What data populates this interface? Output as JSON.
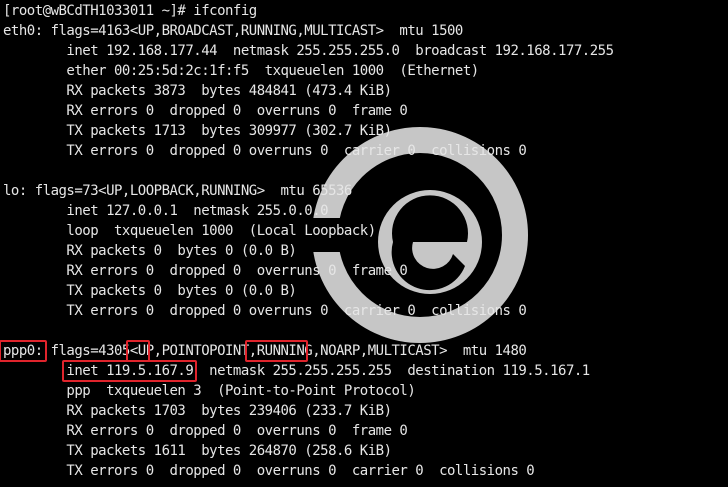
{
  "window": {
    "title": "",
    "background": "#000000",
    "text_color": "#e6e6e6",
    "highlight_color": "#e0242c"
  },
  "terminal": {
    "lines": [
      "[root@wBCdTH1033011 ~]# ifconfig",
      "eth0: flags=4163<UP,BROADCAST,RUNNING,MULTICAST>  mtu 1500",
      "        inet 192.168.177.44  netmask 255.255.255.0  broadcast 192.168.177.255",
      "        ether 00:25:5d:2c:1f:f5  txqueuelen 1000  (Ethernet)",
      "        RX packets 3873  bytes 484841 (473.4 KiB)",
      "        RX errors 0  dropped 0  overruns 0  frame 0",
      "        TX packets 1713  bytes 309977 (302.7 KiB)",
      "        TX errors 0  dropped 0 overruns 0  carrier 0  collisions 0",
      "",
      "lo: flags=73<UP,LOOPBACK,RUNNING>  mtu 65536",
      "        inet 127.0.0.1  netmask 255.0.0.0",
      "        loop  txqueuelen 1000  (Local Loopback)",
      "        RX packets 0  bytes 0 (0.0 B)",
      "        RX errors 0  dropped 0  overruns 0  frame 0",
      "        TX packets 0  bytes 0 (0.0 B)",
      "        TX errors 0  dropped 0 overruns 0  carrier 0  collisions 0",
      "",
      "ppp0: flags=4305<UP,POINTOPOINT,RUNNING,NOARP,MULTICAST>  mtu 1480",
      "        inet 119.5.167.9  netmask 255.255.255.255  destination 119.5.167.1",
      "        ppp  txqueuelen 3  (Point-to-Point Protocol)",
      "        RX packets 1703  bytes 239406 (233.7 KiB)",
      "        RX errors 0  dropped 0  overruns 0  frame 0",
      "        TX packets 1611  bytes 264870 (258.6 KiB)",
      "        TX errors 0  dropped 0  overruns 0  carrier 0  collisions 0"
    ]
  },
  "highlights": [
    {
      "name": "highlight-ppp0-name",
      "line": 17,
      "col_start": 0,
      "col_len": 5
    },
    {
      "name": "highlight-flag-up",
      "line": 17,
      "col_start": 16,
      "col_len": 2
    },
    {
      "name": "highlight-flag-running",
      "line": 17,
      "col_start": 31,
      "col_len": 7
    },
    {
      "name": "highlight-ppp0-inet",
      "line": 18,
      "col_start": 8,
      "col_len": 16
    }
  ],
  "watermark": {
    "icon": "logo-watermark-icon",
    "color": "#dcdcdc"
  }
}
